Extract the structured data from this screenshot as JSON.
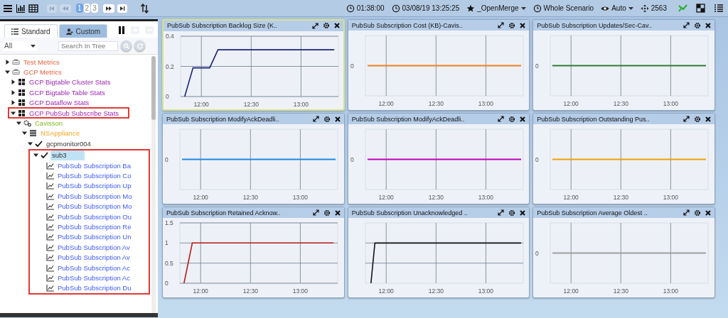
{
  "toolbar": {
    "pages": [
      {
        "label": "1",
        "selected": true
      },
      {
        "label": "2",
        "selected": false
      },
      {
        "label": "3",
        "selected": false
      }
    ],
    "status": [
      {
        "kind": "clock",
        "text": "01:38:00",
        "dropdown": false
      },
      {
        "kind": "clock",
        "text": "03/08/19 13:25:25",
        "dropdown": false
      },
      {
        "kind": "star",
        "text": "_OpenMerge",
        "dropdown": true
      },
      {
        "kind": "clock",
        "text": "Whole Scenario",
        "dropdown": false
      },
      {
        "kind": "eye",
        "text": "Auto",
        "dropdown": true
      },
      {
        "kind": "move",
        "text": "2563",
        "dropdown": false
      }
    ]
  },
  "sidebar": {
    "tabs": [
      {
        "label": "Standard",
        "selected": true
      },
      {
        "label": "Custom",
        "selected": false
      }
    ],
    "filter": {
      "value": "All"
    },
    "search": {
      "placeholder": "Search In Tree"
    }
  },
  "tree": {
    "items": [
      {
        "label": "Test Metrics",
        "kind": "group",
        "expanded": false,
        "selected": false,
        "outlined": false
      },
      {
        "label": "GCP Metrics",
        "kind": "group",
        "expanded": true,
        "selected": false,
        "outlined": false,
        "children": [
          {
            "label": "GCP Bigtable Cluster Stats",
            "kind": "grid",
            "expanded": false,
            "selected": false,
            "outlined": false
          },
          {
            "label": "GCP Bigtable Table Stats",
            "kind": "grid",
            "expanded": false,
            "selected": false,
            "outlined": false
          },
          {
            "label": "GCP Dataflow Stats",
            "kind": "grid",
            "expanded": false,
            "selected": false,
            "outlined": false
          },
          {
            "label": "GCP PubSub Subscribe Stats",
            "kind": "grid",
            "expanded": true,
            "selected": false,
            "outlined": true,
            "children": [
              {
                "label": "Cavisson",
                "kind": "gears",
                "expanded": true,
                "selected": false,
                "outlined": false,
                "children": [
                  {
                    "label": "NSAppliance",
                    "kind": "server",
                    "expanded": true,
                    "selected": false,
                    "outlined": false,
                    "children": [
                      {
                        "label": "gcpmonitor004",
                        "kind": "check",
                        "expanded": true,
                        "selected": false,
                        "outlined": false,
                        "children": [
                          {
                            "label": "sub3",
                            "kind": "check",
                            "expanded": true,
                            "selected": true,
                            "outlined": true,
                            "children": [
                              {
                                "label": "PubSub Subscription Ba",
                                "kind": "chart",
                                "selected": false,
                                "outlined": false
                              },
                              {
                                "label": "PubSub Subscription Co",
                                "kind": "chart",
                                "selected": false,
                                "outlined": false
                              },
                              {
                                "label": "PubSub Subscription Up",
                                "kind": "chart",
                                "selected": false,
                                "outlined": false
                              },
                              {
                                "label": "PubSub Subscription Mo",
                                "kind": "chart",
                                "selected": false,
                                "outlined": false
                              },
                              {
                                "label": "PubSub Subscription Mo",
                                "kind": "chart",
                                "selected": false,
                                "outlined": false
                              },
                              {
                                "label": "PubSub Subscription Ou",
                                "kind": "chart",
                                "selected": false,
                                "outlined": false
                              },
                              {
                                "label": "PubSub Subscription Re",
                                "kind": "chart",
                                "selected": false,
                                "outlined": false
                              },
                              {
                                "label": "PubSub Subscription Un",
                                "kind": "chart",
                                "selected": false,
                                "outlined": false
                              },
                              {
                                "label": "PubSub Subscription Av",
                                "kind": "chart",
                                "selected": false,
                                "outlined": false
                              },
                              {
                                "label": "PubSub Subscription Av",
                                "kind": "chart",
                                "selected": false,
                                "outlined": false
                              },
                              {
                                "label": "PubSub Subscription Ac",
                                "kind": "chart",
                                "selected": false,
                                "outlined": false
                              },
                              {
                                "label": "PubSub Subscription Ac",
                                "kind": "chart",
                                "selected": false,
                                "outlined": false
                              },
                              {
                                "label": "PubSub Subscription Du",
                                "kind": "chart",
                                "selected": false,
                                "outlined": false
                              }
                            ]
                          }
                        ]
                      }
                    ]
                  }
                ]
              }
            ]
          }
        ]
      }
    ]
  },
  "panels": [
    {
      "title": "PubSub Subscription Backlog Size (K..",
      "selected": true,
      "kind": "chart",
      "chart_data": {
        "type": "line",
        "grid": true,
        "categories": [
          null,
          null,
          "12:00",
          null,
          null,
          null,
          null,
          null,
          "12:30",
          null,
          null,
          null,
          null,
          null,
          "13:00",
          null,
          null,
          null,
          null
        ],
        "series": [
          {
            "color": "#1a237e",
            "values": [
              0,
              0.19,
              0.19,
              0.19,
              0.31,
              0.31,
              0.31,
              0.31,
              0.31,
              0.31,
              0.31,
              0.31,
              0.31,
              0.31,
              0.31,
              0.31,
              0.31,
              0.31,
              0.31
            ]
          }
        ],
        "ylim": [
          0,
          0.4
        ],
        "yticks": [
          0,
          0.2,
          0.4
        ]
      }
    },
    {
      "title": "PubSub Subscription Cost (KB)-Cavis..",
      "selected": false,
      "kind": "flat",
      "color": "#f07f1e",
      "y_label": "0",
      "x_labels": [
        "12:00",
        "12:30",
        "13:00"
      ]
    },
    {
      "title": "PubSub Subscription Updates/Sec-Cav..",
      "selected": false,
      "kind": "flat",
      "color": "#2e7d32",
      "y_label": "0",
      "x_labels": [
        "12:00",
        "12:30",
        "13:00"
      ]
    },
    {
      "title": "PubSub Subscription ModifyAckDeadli..",
      "selected": false,
      "kind": "flat",
      "color": "#1e88e5",
      "y_label": "0",
      "x_labels": [
        "12:00",
        "12:30",
        "13:00"
      ]
    },
    {
      "title": "PubSub Subscription ModifyAckDeadli..",
      "selected": false,
      "kind": "flat",
      "color": "#c000c0",
      "y_label": "0",
      "x_labels": [
        "12:00",
        "12:30",
        "13:00"
      ]
    },
    {
      "title": "PubSub Subscription Outstanding Pus..",
      "selected": false,
      "kind": "flat",
      "color": "#f0a000",
      "y_label": "0",
      "x_labels": [
        "12:00",
        "12:30",
        "13:00"
      ]
    },
    {
      "title": "PubSub Subscription Retained Acknow..",
      "selected": false,
      "kind": "chart",
      "chart_data": {
        "type": "line",
        "grid": true,
        "categories": [
          null,
          null,
          "12:00",
          null,
          null,
          null,
          null,
          null,
          "12:30",
          null,
          null,
          null,
          null,
          null,
          "13:00",
          null,
          null,
          null,
          null
        ],
        "series": [
          {
            "color": "#b71c1c",
            "values": [
              0,
              1,
              1,
              1,
              1,
              1,
              1,
              1,
              1,
              1,
              1,
              1,
              1,
              1,
              1,
              1,
              1,
              1,
              1
            ]
          }
        ],
        "ylim": [
          0,
          1.5
        ],
        "yticks": [
          0,
          0.5,
          1,
          1.5
        ]
      }
    },
    {
      "title": "PubSub Subscription Unacknowledged ..",
      "selected": false,
      "kind": "step",
      "color": "#111111",
      "x_labels": [
        "12:00",
        "12:30",
        "13:00"
      ]
    },
    {
      "title": "PubSub Subscription Average Oldest ..",
      "selected": false,
      "kind": "flat",
      "color": "#9e9e9e",
      "y_label": "0",
      "x_labels": [
        "12:00",
        "12:30",
        "13:00"
      ]
    }
  ]
}
